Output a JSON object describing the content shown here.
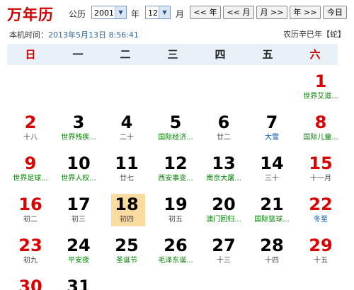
{
  "header": {
    "logo": "万年历",
    "gongli_label": "公历",
    "year_value": "2001",
    "year_suffix": "年",
    "month_value": "12",
    "month_suffix": "月",
    "prev_year": "<< 年",
    "prev_month": "<< 月",
    "next_month": "月 >>",
    "next_year": "年 >>",
    "today": "今日",
    "time_label": "本机时间：",
    "time_value": "2013年5月13日 8:56:41",
    "lunar_year": "农历辛巳年【蛇】"
  },
  "weekdays": [
    "日",
    "一",
    "二",
    "三",
    "四",
    "五",
    "六"
  ],
  "colors": {
    "holiday_red": "#dd0000",
    "festival_green": "#008000",
    "term_blue": "#0055aa",
    "today_bg": "#fbdba0"
  },
  "days": [
    {
      "n": "1",
      "sub": "世界艾滋..."
    },
    {
      "n": "2",
      "sub": "十八"
    },
    {
      "n": "3",
      "sub": "世界残疾..."
    },
    {
      "n": "4",
      "sub": "二十"
    },
    {
      "n": "5",
      "sub": "国际经济..."
    },
    {
      "n": "6",
      "sub": "廿二"
    },
    {
      "n": "7",
      "sub": "大雪"
    },
    {
      "n": "8",
      "sub": "国际儿童..."
    },
    {
      "n": "9",
      "sub": "世界足球..."
    },
    {
      "n": "10",
      "sub": "世界人权..."
    },
    {
      "n": "11",
      "sub": "廿七"
    },
    {
      "n": "12",
      "sub": "西安事变..."
    },
    {
      "n": "13",
      "sub": "南京大屠..."
    },
    {
      "n": "14",
      "sub": "三十"
    },
    {
      "n": "15",
      "sub": "十一月"
    },
    {
      "n": "16",
      "sub": "初二"
    },
    {
      "n": "17",
      "sub": "初三"
    },
    {
      "n": "18",
      "sub": "初四"
    },
    {
      "n": "19",
      "sub": "初五"
    },
    {
      "n": "20",
      "sub": "澳门回归..."
    },
    {
      "n": "21",
      "sub": "国际篮球..."
    },
    {
      "n": "22",
      "sub": "冬至"
    },
    {
      "n": "23",
      "sub": "初九"
    },
    {
      "n": "24",
      "sub": "平安夜"
    },
    {
      "n": "25",
      "sub": "圣诞节"
    },
    {
      "n": "26",
      "sub": "毛泽东诞..."
    },
    {
      "n": "27",
      "sub": "十三"
    },
    {
      "n": "28",
      "sub": "十四"
    },
    {
      "n": "29",
      "sub": "十五"
    },
    {
      "n": "30",
      "sub": ""
    },
    {
      "n": "31",
      "sub": ""
    }
  ]
}
